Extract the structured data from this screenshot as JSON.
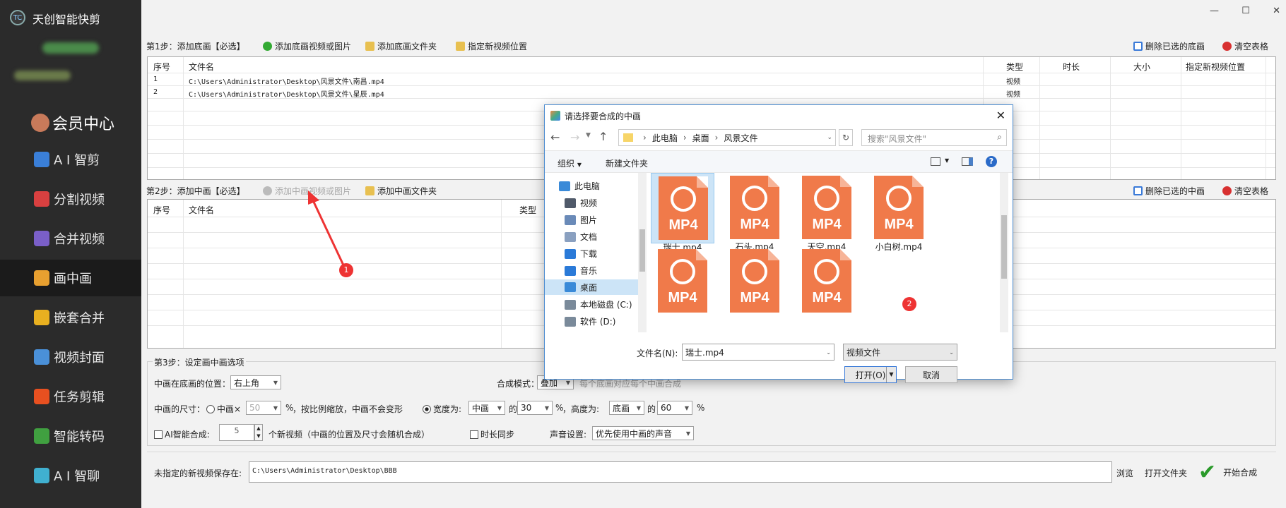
{
  "app": {
    "title": "天创智能快剪",
    "window_controls": [
      "minimize-icon",
      "maximize-icon",
      "close-icon"
    ]
  },
  "sidebar": {
    "member": "会员中心",
    "items": [
      {
        "label": "A I 智剪",
        "icon": "ai-icon",
        "color": "#3a7fd8"
      },
      {
        "label": "分割视频",
        "icon": "split-icon",
        "color": "#d94040"
      },
      {
        "label": "合并视频",
        "icon": "merge-icon",
        "color": "#7a5fc8"
      },
      {
        "label": "画中画",
        "icon": "pip-icon",
        "color": "#e8a030"
      },
      {
        "label": "嵌套合并",
        "icon": "nest-icon",
        "color": "#e8b020"
      },
      {
        "label": "视频封面",
        "icon": "cover-icon",
        "color": "#4a90d8"
      },
      {
        "label": "任务剪辑",
        "icon": "task-icon",
        "color": "#e85020"
      },
      {
        "label": "智能转码",
        "icon": "transcode-icon",
        "color": "#40a040"
      },
      {
        "label": "A I 智聊",
        "icon": "chat-icon",
        "color": "#40b0d0"
      }
    ],
    "active_index": 3
  },
  "step1": {
    "title": "第1步：添加底画【必选】",
    "add_media": "添加底画视频或图片",
    "add_folder": "添加底画文件夹",
    "set_position": "指定新视频位置",
    "delete_selected": "删除已选的底画",
    "clear": "清空表格",
    "columns": [
      "序号",
      "文件名",
      "类型",
      "时长",
      "大小",
      "指定新视频位置"
    ],
    "rows": [
      [
        "1",
        "C:\\Users\\Administrator\\Desktop\\风景文件\\南昌.mp4",
        "视频",
        "",
        "",
        ""
      ],
      [
        "2",
        "C:\\Users\\Administrator\\Desktop\\风景文件\\星辰.mp4",
        "视频",
        "",
        "",
        ""
      ]
    ]
  },
  "step2": {
    "title": "第2步：添加中画【必选】",
    "add_media": "添加中画视频或图片",
    "add_folder": "添加中画文件夹",
    "delete_selected": "删除已选的中画",
    "clear": "清空表格",
    "columns": [
      "序号",
      "文件名",
      "类型"
    ]
  },
  "step3": {
    "title": "第3步：设定画中画选项",
    "position_label": "中画在底画的位置：",
    "position_value": "右上角",
    "mode_label": "合成模式：",
    "mode_value": "叠加",
    "mode_note": "每个底画对应每个中画合成",
    "size_label": "中画的尺寸：",
    "size_opt1": "中画×",
    "size_pct": "50",
    "pct": "%",
    "size_note": "，按比例缩放，中画不会变形",
    "width_label": "宽度为:",
    "width_ref": "中画",
    "of": "的",
    "width_val": "30",
    "height_label": "，高度为:",
    "height_ref": "底画",
    "height_val": "60",
    "ai_label": "AI智能合成:",
    "ai_count": "5",
    "ai_note": "个新视频（中画的位置及尺寸会随机合成）",
    "sync_label": "时长同步",
    "audio_label": "声音设置:",
    "audio_value": "优先使用中画的声音"
  },
  "bottom": {
    "save_label": "未指定的新视频保存在:",
    "save_path": "C:\\Users\\Administrator\\Desktop\\BBB",
    "browse": "浏览",
    "open_folder": "打开文件夹",
    "start": "开始合成"
  },
  "annotations": {
    "marker1": "1",
    "marker2": "2"
  },
  "dialog": {
    "title": "请选择要合成的中画",
    "breadcrumb": [
      "此电脑",
      "桌面",
      "风景文件"
    ],
    "search_placeholder": "搜索\"风景文件\"",
    "organize": "组织",
    "new_folder": "新建文件夹",
    "nav": [
      {
        "label": "此电脑",
        "icon": "computer-icon",
        "color": "#3a8ad8"
      },
      {
        "label": "视频",
        "icon": "video-folder-icon",
        "color": "#505a6a"
      },
      {
        "label": "图片",
        "icon": "pictures-folder-icon",
        "color": "#6a8ab8"
      },
      {
        "label": "文档",
        "icon": "documents-folder-icon",
        "color": "#8aa0c0"
      },
      {
        "label": "下载",
        "icon": "download-icon",
        "color": "#2a7ad8"
      },
      {
        "label": "音乐",
        "icon": "music-icon",
        "color": "#2a7ad8"
      },
      {
        "label": "桌面",
        "icon": "desktop-folder-icon",
        "color": "#3a8ad8"
      },
      {
        "label": "本地磁盘 (C:)",
        "icon": "disk-icon",
        "color": "#7a8a9a"
      },
      {
        "label": "软件 (D:)",
        "icon": "disk-icon",
        "color": "#7a8a9a"
      }
    ],
    "selected_nav": 6,
    "file_badge": "MP4",
    "files": [
      {
        "name": "瑞士.mp4"
      },
      {
        "name": "石头.mp4"
      },
      {
        "name": "天空.mp4"
      },
      {
        "name": "小白树.mp4"
      },
      {
        "name": ""
      },
      {
        "name": ""
      },
      {
        "name": ""
      }
    ],
    "filename_label": "文件名(N):",
    "filename_value": "瑞士.mp4",
    "filetype_value": "视频文件",
    "open": "打开(O)",
    "cancel": "取消"
  }
}
